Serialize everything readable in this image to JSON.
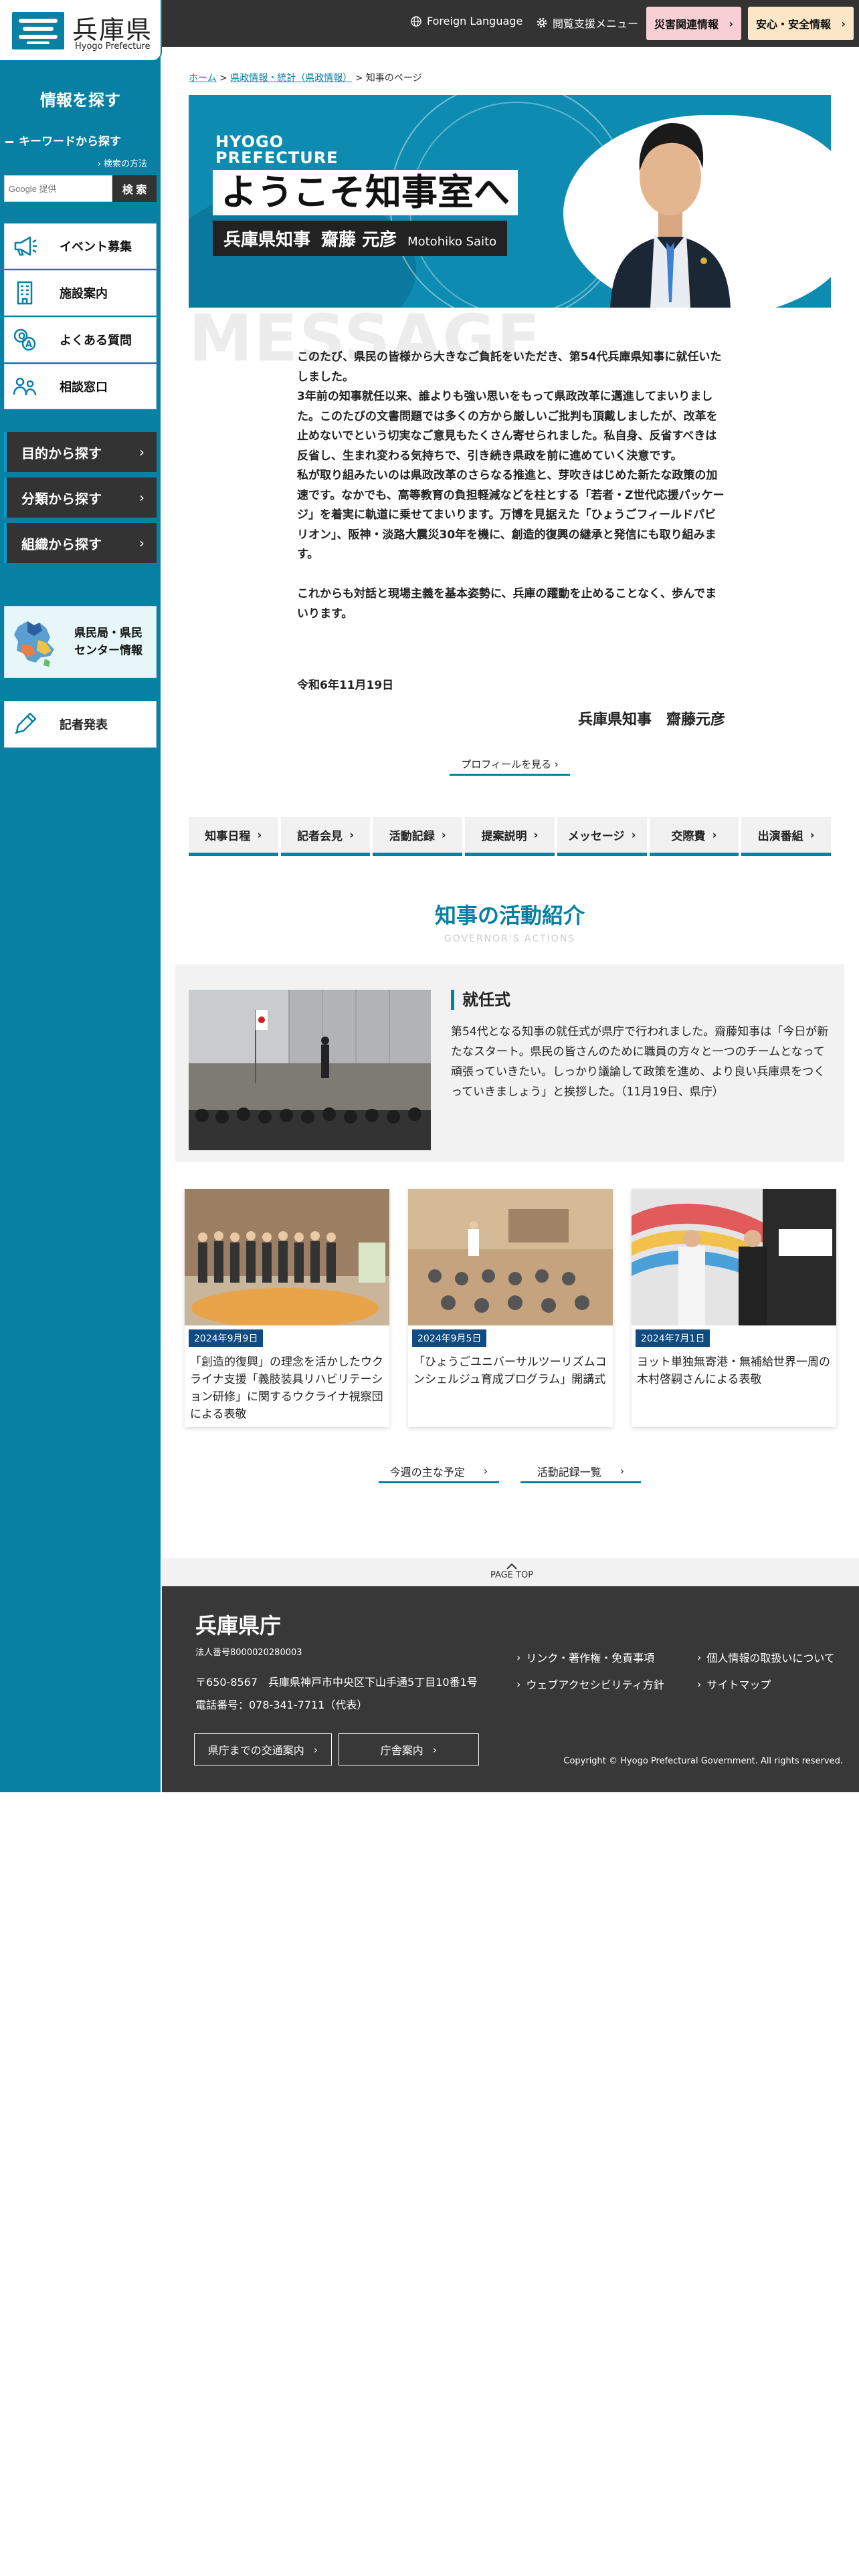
{
  "logo": {
    "title": "兵庫県",
    "subtitle": "Hyogo Prefecture"
  },
  "topbar": {
    "foreign_language": "Foreign Language",
    "accessibility_menu": "閲覧支援メニュー",
    "disaster_button": "災害関連情報",
    "safety_button": "安心・安全情報",
    "colors": {
      "disaster_bg": "#f8d0d4",
      "safety_bg": "#fbe7c8"
    }
  },
  "sidebar": {
    "heading": "情報を探す",
    "keyword_label": "キーワードから探す",
    "usage_link": "検索の方法",
    "search_placeholder": "Google 提供",
    "search_button": "検 索",
    "items": [
      {
        "label": "イベント募集",
        "icon": "megaphone-icon"
      },
      {
        "label": "施設案内",
        "icon": "building-icon"
      },
      {
        "label": "よくある質問",
        "icon": "question-icon"
      },
      {
        "label": "相談窓口",
        "icon": "consultation-icon"
      }
    ],
    "dark_items": [
      {
        "label": "目的から探す"
      },
      {
        "label": "分類から探す"
      },
      {
        "label": "組織から探す"
      }
    ],
    "center_card": "県民局・県民\nセンター情報",
    "press": "記者発表"
  },
  "breadcrumb": {
    "home": "ホーム",
    "section": "県政情報・統計（県政情報）",
    "current": "知事のページ"
  },
  "hero": {
    "en_line1": "HYOGO",
    "en_line2": "PREFECTURE",
    "title": "ようこそ知事室へ",
    "role": "兵庫県知事",
    "name": "齋藤 元彦",
    "name_romaji": "Motohiko Saito"
  },
  "message": {
    "bg_text": "MESSAGE",
    "paragraphs": [
      "このたび、県民の皆様から大きなご負託をいただき、第54代兵庫県知事に就任いたしました。",
      "3年前の知事就任以来、誰よりも強い思いをもって県政改革に邁進してまいりました。このたびの文書問題では多くの方から厳しいご批判も頂戴しましたが、改革を止めないでという切実なご意見もたくさん寄せられました。私自身、反省すべきは反省し、生まれ変わる気持ちで、引き続き県政を前に進めていく決意です。",
      "私が取り組みたいのは県政改革のさらなる推進と、芽吹きはじめた新たな政策の加速です。なかでも、高等教育の負担軽減などを柱とする「若者・Z世代応援パッケージ」を着実に軌道に乗せてまいります。万博を見据えた「ひょうごフィールドパビリオン」、阪神・淡路大震災30年を機に、創造的復興の継承と発信にも取り組みます。",
      "",
      "これからも対話と現場主義を基本姿勢に、兵庫の躍動を止めることなく、歩んでまいります。"
    ],
    "date": "令和6年11月19日",
    "signature": "兵庫県知事　齋藤元彦",
    "profile_link": "プロフィールを見る"
  },
  "tabs": [
    "知事日程",
    "記者会見",
    "活動記録",
    "提案説明",
    "メッセージ",
    "交際費",
    "出演番組"
  ],
  "activities": {
    "title": "知事の活動紹介",
    "subtitle": "GOVERNOR'S ACTIONS",
    "feature": {
      "heading": "就任式",
      "text": "第54代となる知事の就任式が県庁で行われました。齋藤知事は「今日が新たなスタート。県民の皆さんのために職員の方々と一つのチームとなって頑張っていきたい。しっかり議論して政策を進め、より良い兵庫県をつくっていきましょう」と挨拶した。（11月19日、県庁）"
    },
    "cards": [
      {
        "date": "2024年9月9日",
        "caption": "「創造的復興」の理念を活かしたウクライナ支援「義肢装具リハビリテーション研修」に関するウクライナ視察団による表敬"
      },
      {
        "date": "2024年9月5日",
        "caption": "「ひょうごユニバーサルツーリズムコンシェルジュ育成プログラム」開講式"
      },
      {
        "date": "2024年7月1日",
        "caption": "ヨット単独無寄港・無補給世界一周の木村啓嗣さんによる表敬"
      }
    ],
    "more_links": [
      "今週の主な予定",
      "活動記録一覧"
    ]
  },
  "page_top": "PAGE TOP",
  "footer": {
    "title": "兵庫県庁",
    "corporate_number": "法人番号8000020280003",
    "address": "〒650-8567　兵庫県神戸市中央区下山手通5丁目10番1号",
    "tel": "電話番号：078-341-7711（代表）",
    "buttons": [
      "県庁までの交通案内",
      "庁舎案内"
    ],
    "links": [
      "リンク・著作権・免責事項",
      "個人情報の取扱いについて",
      "ウェブアクセシビリティ方針",
      "サイトマップ"
    ],
    "copyright": "Copyright © Hyogo Prefectural Government. All rights reserved."
  },
  "colors": {
    "brand": "#0780a4",
    "dark": "#333333",
    "date_badge": "#0f4c81"
  }
}
